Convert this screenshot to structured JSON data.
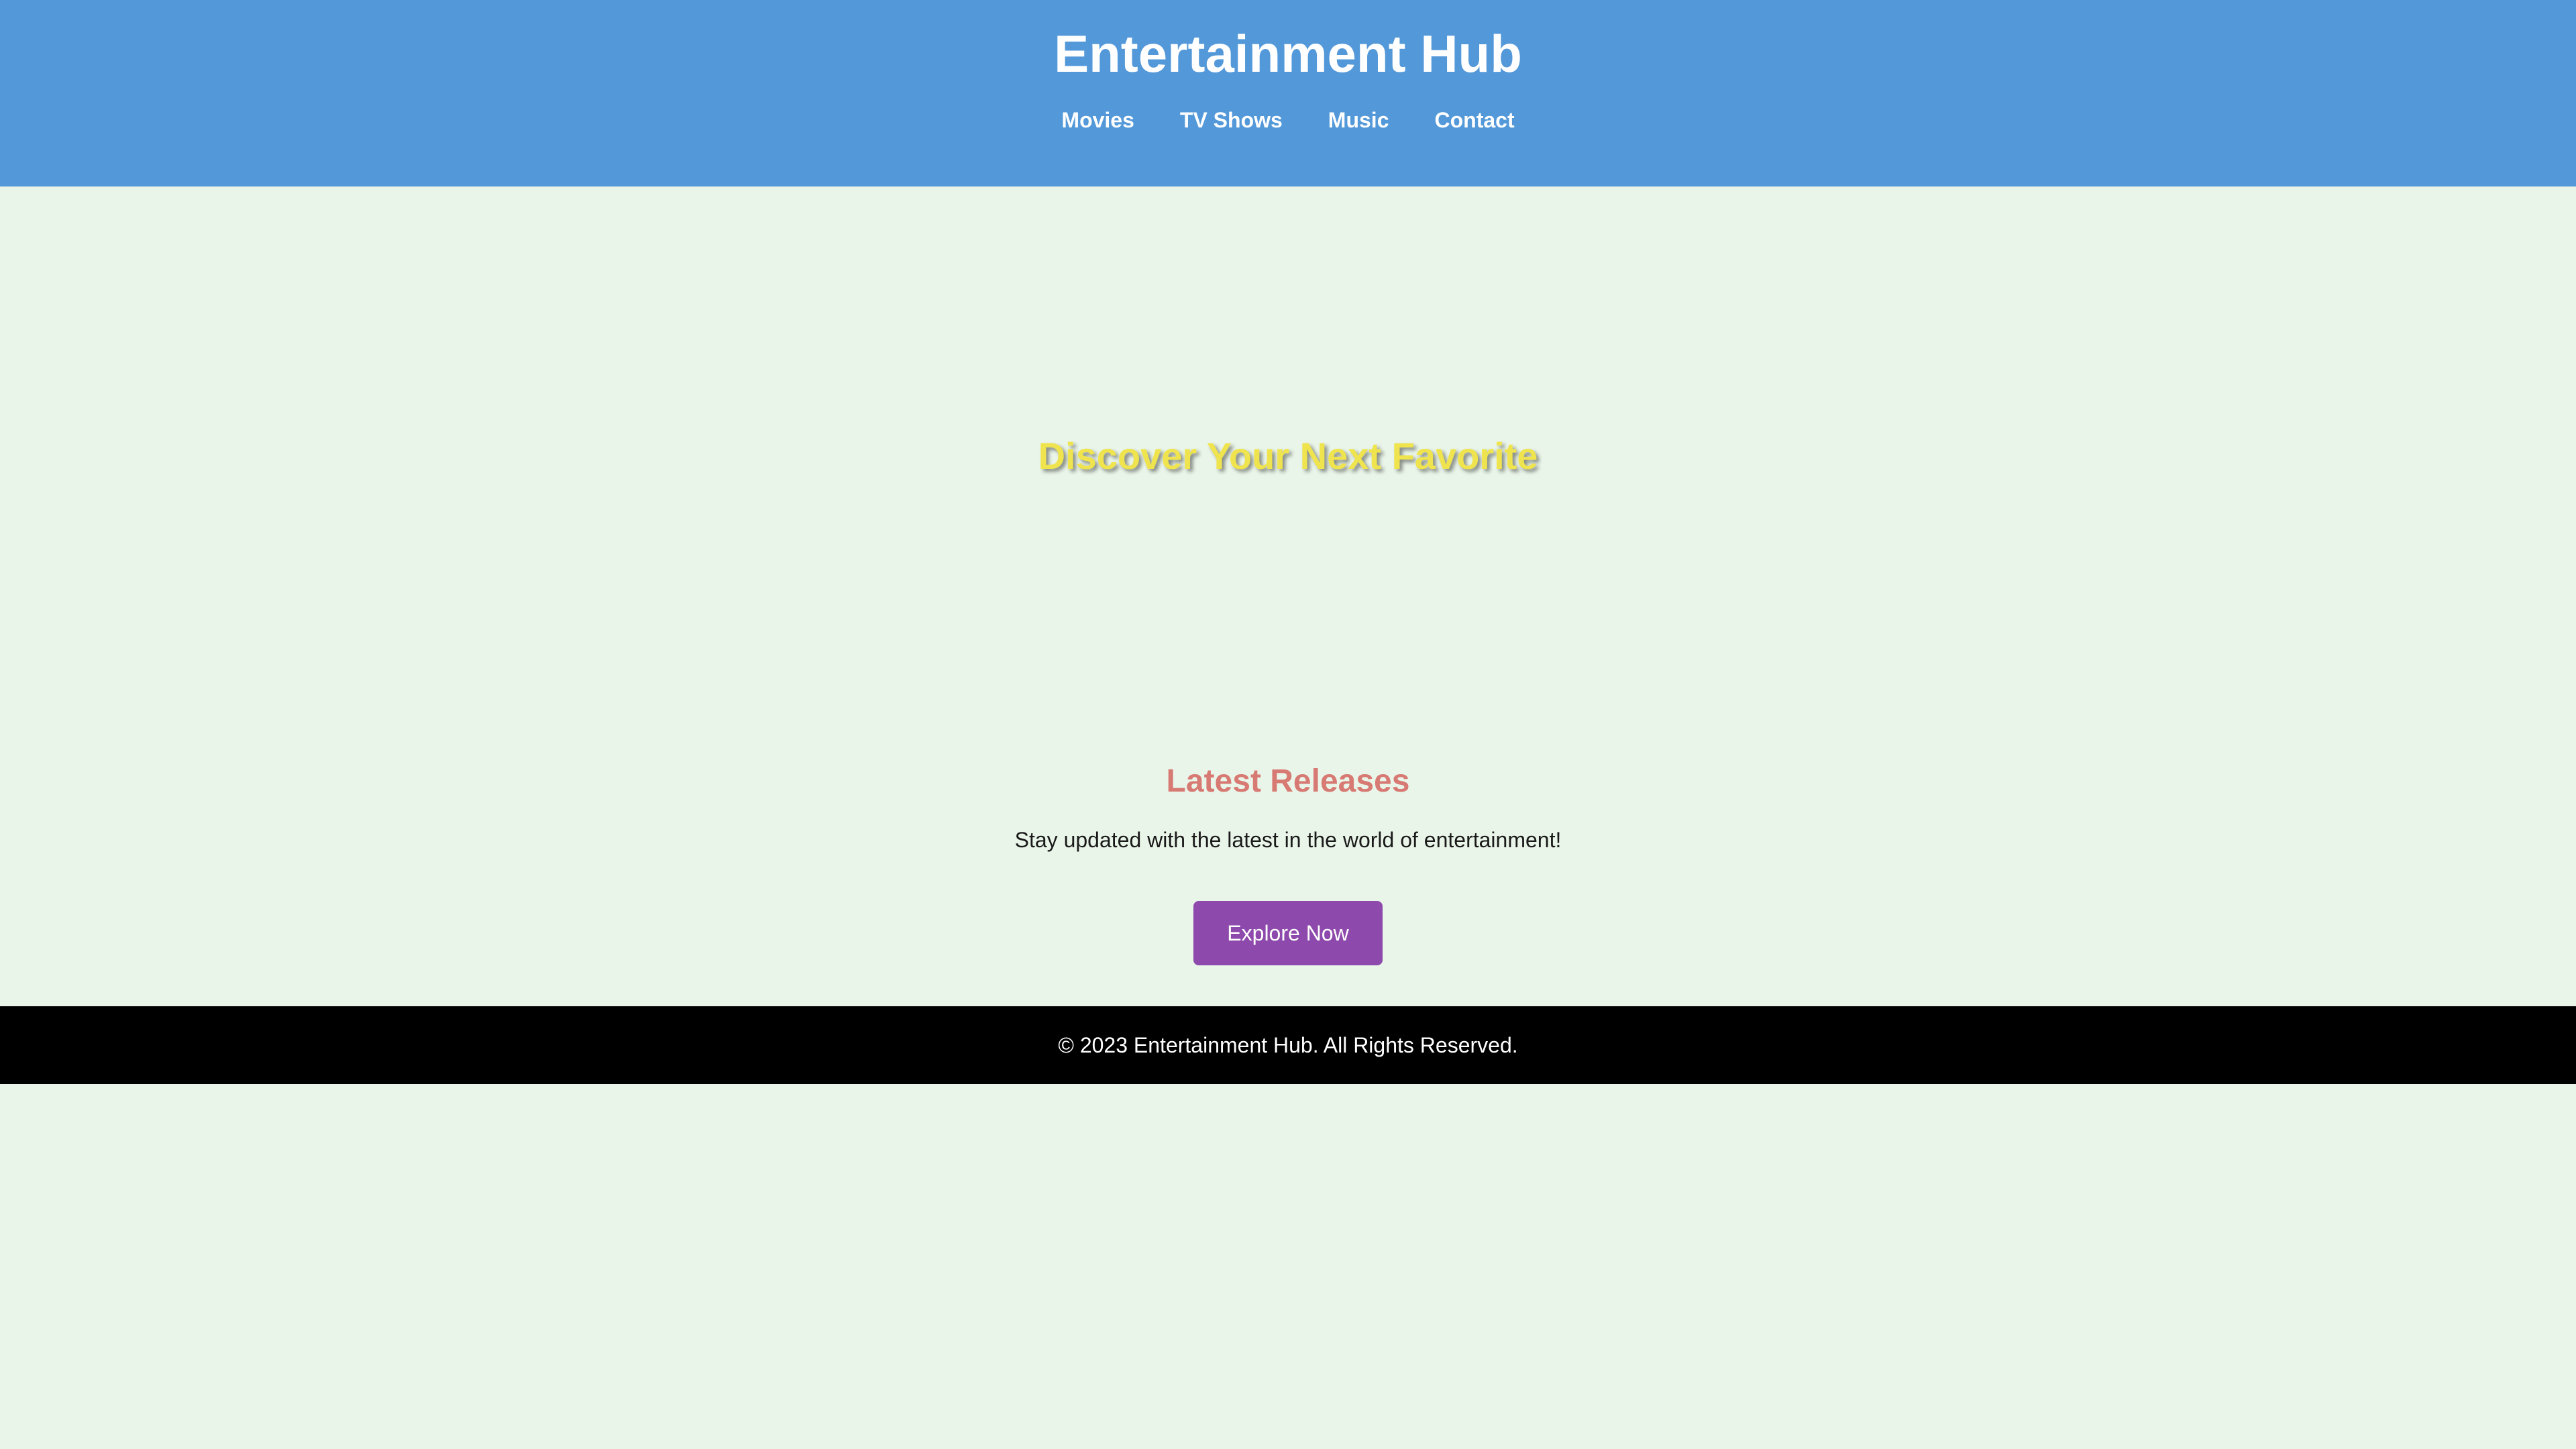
{
  "header": {
    "title": "Entertainment Hub",
    "nav": [
      {
        "label": "Movies"
      },
      {
        "label": "TV Shows"
      },
      {
        "label": "Music"
      },
      {
        "label": "Contact"
      }
    ]
  },
  "hero": {
    "title": "Discover Your Next Favorite"
  },
  "latest": {
    "title": "Latest Releases",
    "text": "Stay updated with the latest in the world of entertainment!",
    "button_label": "Explore Now"
  },
  "footer": {
    "text": "© 2023 Entertainment Hub. All Rights Reserved."
  },
  "colors": {
    "header_bg": "#5398d8",
    "page_bg": "#eaf5e9",
    "hero_text": "#f0e44e",
    "section_title": "#d77a73",
    "button_bg": "#8d49ab",
    "footer_bg": "#000000"
  }
}
